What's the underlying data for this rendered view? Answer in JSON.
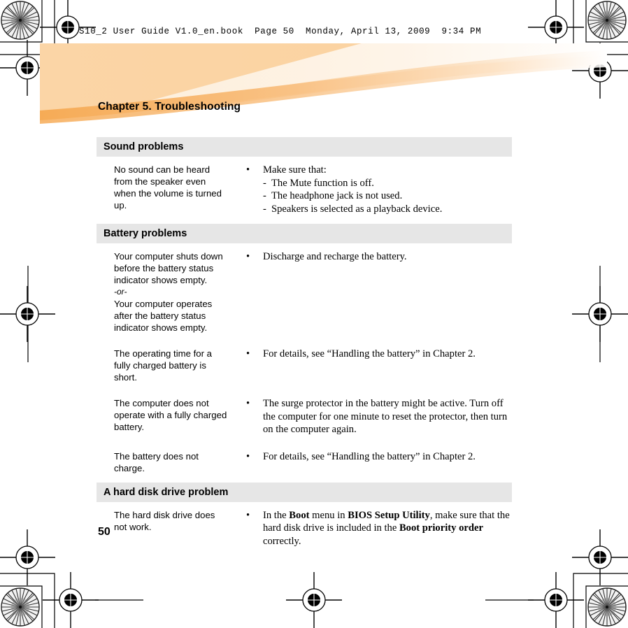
{
  "page": {
    "header_line": "S10_2 User Guide V1.0_en.book  Page 50  Monday, April 13, 2009  9:34 PM",
    "chapter_title": "Chapter 5. Troubleshooting",
    "folio": "50",
    "banner_color": "#fad2a0",
    "banner_accent_color": "#f6ab56",
    "section_header_bg": "#e6e6e6"
  },
  "sections": [
    {
      "heading": "Sound problems",
      "rows": [
        {
          "symptom_lines": [
            "No sound can be heard",
            "from the speaker even",
            "when the volume is turned",
            "up."
          ],
          "bullet": "•",
          "solution_lead": "Make sure that:",
          "sub_items": [
            "The Mute function is off.",
            "The headphone jack is not used.",
            "Speakers is selected as a playback device."
          ]
        }
      ]
    },
    {
      "heading": "Battery problems",
      "rows": [
        {
          "symptom_lines": [
            "Your computer shuts down",
            "before the battery status",
            "indicator shows empty."
          ],
          "symptom_or": "-or-",
          "symptom_lines2": [
            "Your computer operates",
            "after the battery status",
            "indicator shows empty."
          ],
          "bullet": "•",
          "solution_lead": "Discharge and recharge the battery.",
          "sub_items": []
        },
        {
          "symptom_lines": [
            "The operating time for a",
            "fully charged battery is",
            "short."
          ],
          "bullet": "•",
          "solution_lead": "For details, see “Handling the battery” in Chapter 2.",
          "sub_items": []
        },
        {
          "symptom_lines": [
            "The computer does not",
            "operate with a fully charged",
            "battery."
          ],
          "bullet": "•",
          "solution_lead": "The surge protector in the battery might be active. Turn off the computer for one minute to reset the protector, then turn on the computer again.",
          "sub_items": []
        },
        {
          "symptom_lines": [
            "The battery does not",
            "charge."
          ],
          "bullet": "•",
          "solution_lead": "For details, see “Handling the battery” in Chapter 2.",
          "sub_items": []
        }
      ]
    },
    {
      "heading": "A hard disk drive problem",
      "rows": [
        {
          "symptom_lines": [
            "The hard disk drive does",
            "not work."
          ],
          "bullet": "•",
          "solution_rich": {
            "p1": "In the ",
            "b1": "Boot",
            "p2": " menu in ",
            "b2": "BIOS Setup Utility",
            "p3": ", make sure that the hard disk drive is included in the ",
            "b3": "Boot priority order",
            "p4": " correctly."
          },
          "sub_items": []
        }
      ]
    }
  ]
}
